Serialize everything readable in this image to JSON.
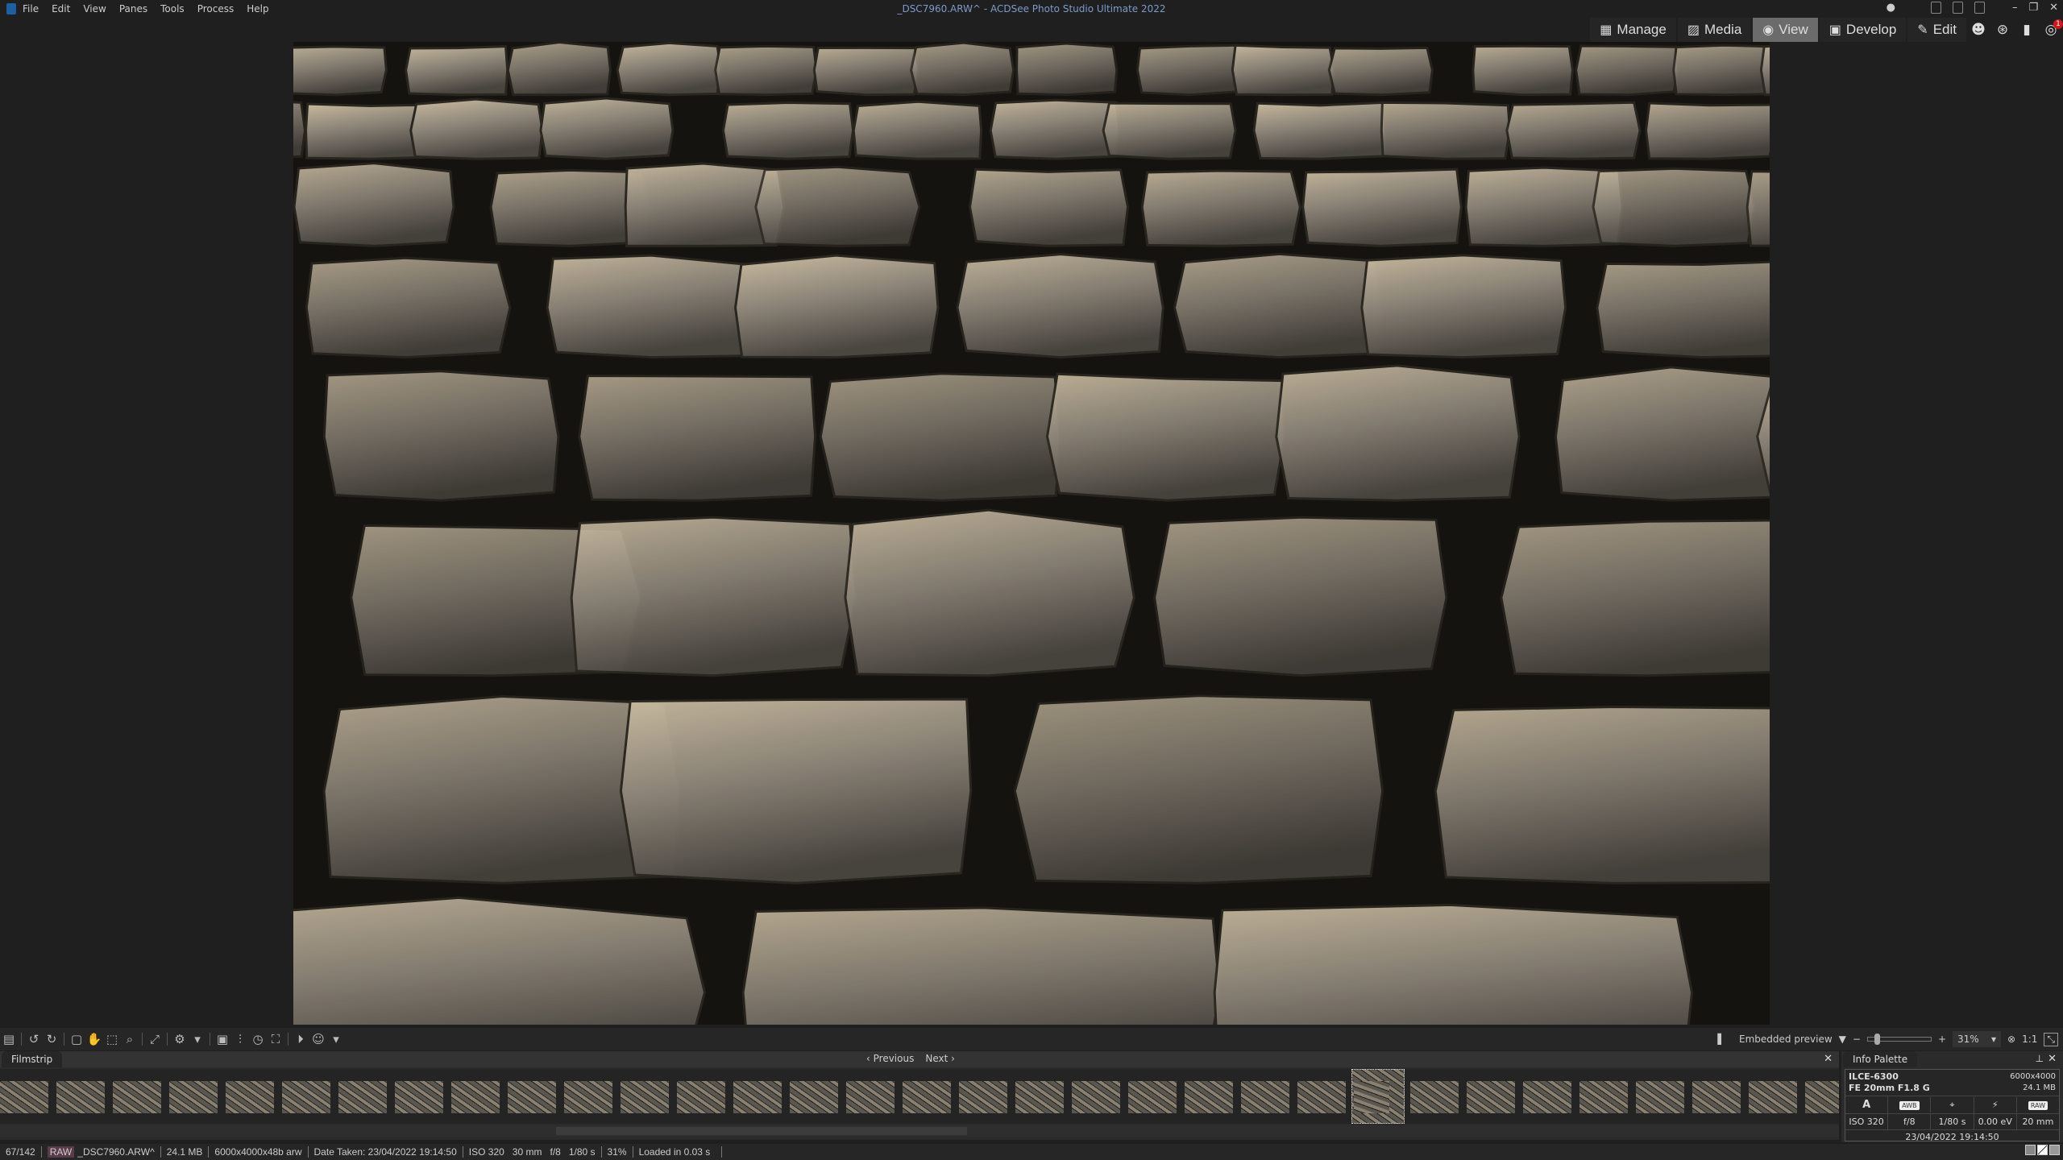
{
  "window": {
    "title": "_DSC7960.ARW^ - ACDSee Photo Studio Ultimate 2022"
  },
  "menu": [
    "File",
    "Edit",
    "View",
    "Panes",
    "Tools",
    "Process",
    "Help"
  ],
  "modes": [
    {
      "label": "Manage",
      "icon": "grid-icon"
    },
    {
      "label": "Media",
      "icon": "media-icon"
    },
    {
      "label": "View",
      "icon": "eye-icon",
      "active": true
    },
    {
      "label": "Develop",
      "icon": "develop-icon"
    },
    {
      "label": "Edit",
      "icon": "edit-icon"
    }
  ],
  "extra_icons": {
    "notification_count": "1"
  },
  "viewer": {
    "preview_mode": "Embedded preview",
    "zoom": "31%",
    "actual_size": "1:1"
  },
  "filmstrip": {
    "title": "Filmstrip",
    "previous": "Previous",
    "next": "Next",
    "selected_index": 24,
    "thumb_count": 33
  },
  "info_palette": {
    "title": "Info Palette",
    "camera": "ILCE-6300",
    "lens": "FE 20mm F1.8 G",
    "dimensions": "6000x4000",
    "size": "24.1 MB",
    "mode": "A",
    "wb": "AWB",
    "raw": "RAW",
    "iso": "ISO 320",
    "aperture": "f/8",
    "shutter": "1/80 s",
    "ev": "0.00 eV",
    "focal": "20 mm",
    "date": "23/04/2022 19:14:50"
  },
  "status": {
    "position": "67/142",
    "type": "RAW",
    "filename": "_DSC7960.ARW^",
    "filesize": "24.1 MB",
    "format": "6000x4000x48b arw",
    "date_taken": "Date Taken: 23/04/2022 19:14:50",
    "exif": "ISO 320   30 mm   f/8   1/80 s",
    "zoom": "31%",
    "load_time": "Loaded in 0.03 s"
  }
}
